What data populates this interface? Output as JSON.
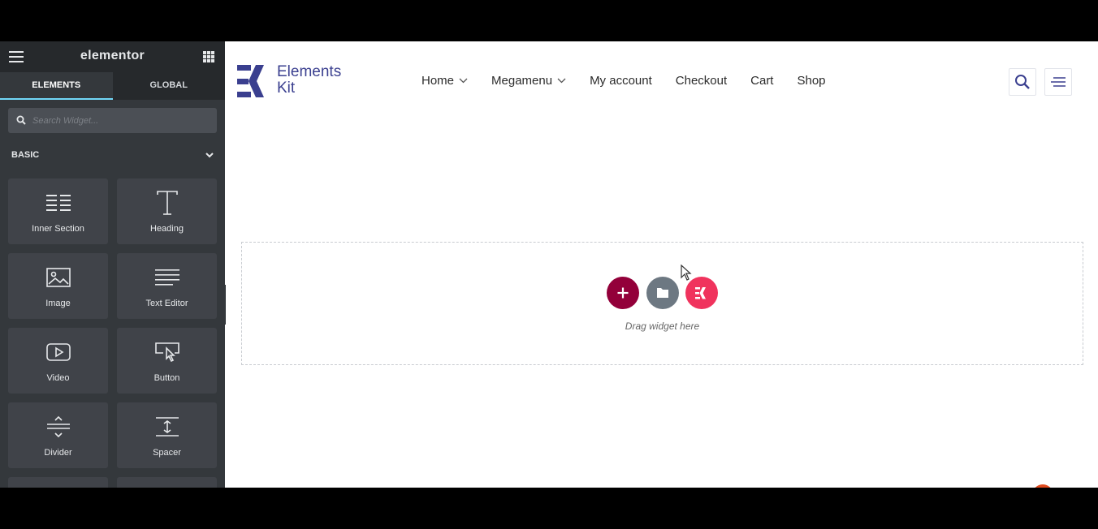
{
  "sidebar": {
    "brand": "elementor",
    "tabs": [
      "ELEMENTS",
      "GLOBAL"
    ],
    "search_placeholder": "Search Widget...",
    "category": "BASIC",
    "widgets": [
      {
        "label": "Inner Section",
        "icon": "inner-section-icon"
      },
      {
        "label": "Heading",
        "icon": "heading-icon"
      },
      {
        "label": "Image",
        "icon": "image-icon"
      },
      {
        "label": "Text Editor",
        "icon": "text-editor-icon"
      },
      {
        "label": "Video",
        "icon": "video-icon"
      },
      {
        "label": "Button",
        "icon": "button-icon"
      },
      {
        "label": "Divider",
        "icon": "divider-icon"
      },
      {
        "label": "Spacer",
        "icon": "spacer-icon"
      }
    ]
  },
  "site": {
    "logo_line1": "Elements",
    "logo_line2": "Kit",
    "nav": [
      "Home",
      "Megamenu",
      "My account",
      "Checkout",
      "Cart",
      "Shop"
    ]
  },
  "dropzone": {
    "text": "Drag widget here"
  },
  "colors": {
    "sidebar_bg": "#34383c",
    "accent_tab": "#71d7f7",
    "brand_blue": "#3a3f8f",
    "add_button": "#93003a",
    "template_button": "#6d7882",
    "elementskit_button": "#f0335d"
  }
}
